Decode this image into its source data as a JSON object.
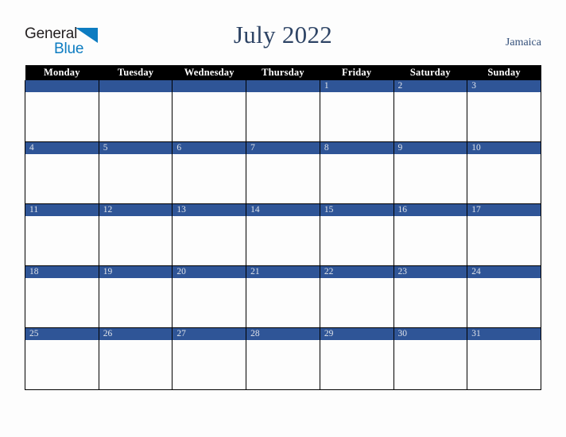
{
  "brand": {
    "word_one": "General",
    "word_two": "Blue",
    "triangle_icon": "blue-triangle-icon",
    "color_dark": "#231f20",
    "color_blue": "#0d7cc1"
  },
  "header": {
    "title": "July 2022",
    "country": "Jamaica",
    "title_color": "#2e4465",
    "country_color": "#34507a"
  },
  "calendar": {
    "month": "July",
    "year": "2022",
    "accent_color": "#2f5597",
    "header_bg": "#000000",
    "header_text_color": "#ffffff",
    "day_number_color": "#dfe3ea",
    "weekday_headers": [
      "Monday",
      "Tuesday",
      "Wednesday",
      "Thursday",
      "Friday",
      "Saturday",
      "Sunday"
    ],
    "weeks": [
      [
        "",
        "",
        "",
        "",
        "1",
        "2",
        "3"
      ],
      [
        "4",
        "5",
        "6",
        "7",
        "8",
        "9",
        "10"
      ],
      [
        "11",
        "12",
        "13",
        "14",
        "15",
        "16",
        "17"
      ],
      [
        "18",
        "19",
        "20",
        "21",
        "22",
        "23",
        "24"
      ],
      [
        "25",
        "26",
        "27",
        "28",
        "29",
        "30",
        "31"
      ]
    ],
    "events": [
      [
        "",
        "",
        "",
        "",
        "",
        "",
        ""
      ],
      [
        "",
        "",
        "",
        "",
        "",
        "",
        ""
      ],
      [
        "",
        "",
        "",
        "",
        "",
        "",
        ""
      ],
      [
        "",
        "",
        "",
        "",
        "",
        "",
        ""
      ],
      [
        "",
        "",
        "",
        "",
        "",
        "",
        ""
      ]
    ]
  }
}
